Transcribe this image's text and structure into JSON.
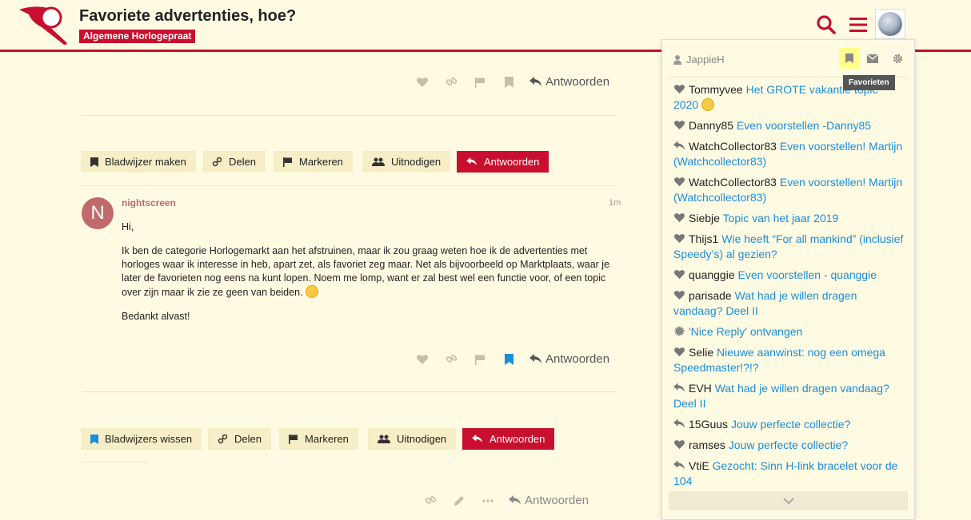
{
  "header": {
    "title": "Favoriete advertenties, hoe?",
    "category": "Algemene Horlogepraat"
  },
  "post_actions_1": {
    "reply": "Antwoorden"
  },
  "buttons_1": {
    "bookmark": "Bladwijzer maken",
    "share": "Delen",
    "flag": "Markeren",
    "invite": "Uitnodigen",
    "reply": "Antwoorden"
  },
  "post": {
    "avatar_letter": "N",
    "username": "nightscreen",
    "date": "1m",
    "p1": "Hi,",
    "p2": "Ik ben de categorie Horlogemarkt aan het afstruinen, maar ik zou graag weten hoe ik de advertenties met horloges waar ik interesse in heb, apart zet, als favoriet zeg maar. Net als bijvoorbeeld op Marktplaats, waar je later de favorieten nog eens na kunt lopen. Noem me lomp, want er zal best wel een functie voor, of een topic over zijn maar ik zie ze geen van beiden.",
    "p3": "Bedankt alvast!",
    "reply": "Antwoorden"
  },
  "buttons_2": {
    "bookmark_clear": "Bladwijzers wissen",
    "share": "Delen",
    "flag": "Markeren",
    "invite": "Uitnodigen",
    "reply": "Antwoorden"
  },
  "bottom_actions": {
    "reply": "Antwoorden"
  },
  "panel": {
    "user": "JappieH",
    "tooltip": "Favorieten",
    "notifications": [
      {
        "icon": "heart-icon",
        "user": "Tommyvee",
        "text": "Het GROTE vakantie topic 2020",
        "emoji": true
      },
      {
        "icon": "heart-icon",
        "user": "Danny85",
        "text": "Even voorstellen -Danny85"
      },
      {
        "icon": "reply-icon",
        "user": "WatchCollector83",
        "text": "Even voorstellen! Martijn (Watchcollector83)"
      },
      {
        "icon": "heart-icon",
        "user": "WatchCollector83",
        "text": "Even voorstellen! Martijn (Watchcollector83)"
      },
      {
        "icon": "heart-icon",
        "user": "Siebje",
        "text": "Topic van het jaar 2019"
      },
      {
        "icon": "heart-icon",
        "user": "Thijs1",
        "text": "Wie heeft “For all mankind” (inclusief Speedy’s) al gezien?"
      },
      {
        "icon": "heart-icon",
        "user": "quanggie",
        "text": "Even voorstellen - quanggie"
      },
      {
        "icon": "heart-icon",
        "user": "parisade",
        "text": "Wat had je willen dragen vandaag? Deel II"
      },
      {
        "icon": "badge-icon",
        "user": "",
        "text": "'Nice Reply' ontvangen"
      },
      {
        "icon": "heart-icon",
        "user": "Selie",
        "text": "Nieuwe aanwinst: nog een omega Speedmaster!?!?"
      },
      {
        "icon": "reply-icon",
        "user": "EVH",
        "text": "Wat had je willen dragen vandaag? Deel II"
      },
      {
        "icon": "reply-icon",
        "user": "15Guus",
        "text": "Jouw perfecte collectie?"
      },
      {
        "icon": "heart-icon",
        "user": "ramses",
        "text": "Jouw perfecte collectie?"
      },
      {
        "icon": "reply-icon",
        "user": "VtiE",
        "text": "Gezocht: Sinn H-link bracelet voor de 104"
      }
    ]
  },
  "colors": {
    "accent": "#c8102e",
    "link": "#1a8dd8",
    "background": "#fffbe3"
  }
}
